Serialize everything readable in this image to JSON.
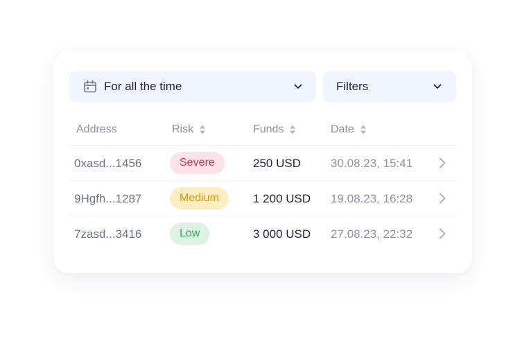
{
  "filters": {
    "date_range_label": "For all the time",
    "filters_label": "Filters"
  },
  "table": {
    "headers": {
      "address": "Address",
      "risk": "Risk",
      "funds": "Funds",
      "date": "Date"
    },
    "rows": [
      {
        "address": "0xasd...1456",
        "risk": "Severe",
        "risk_colors": {
          "bg": "#fde2e7",
          "text": "#d8364f"
        },
        "funds": "250 USD",
        "date": "30.08.23, 15:41"
      },
      {
        "address": "9Hgfh...1287",
        "risk": "Medium",
        "risk_colors": {
          "bg": "#fdeec2",
          "text": "#d79a10"
        },
        "funds": "1 200 USD",
        "date": "19.08.23, 16:28"
      },
      {
        "address": "7zasd...3416",
        "risk": "Low",
        "risk_colors": {
          "bg": "#dcf3e4",
          "text": "#2fa760"
        },
        "funds": "3 000 USD",
        "date": "27.08.23, 22:32"
      }
    ]
  },
  "icons": {
    "date_dropdown": "calendar-icon",
    "dropdown_caret": "chevron-down-icon",
    "sort": "sort-icon",
    "row_open": "chevron-right-icon"
  }
}
